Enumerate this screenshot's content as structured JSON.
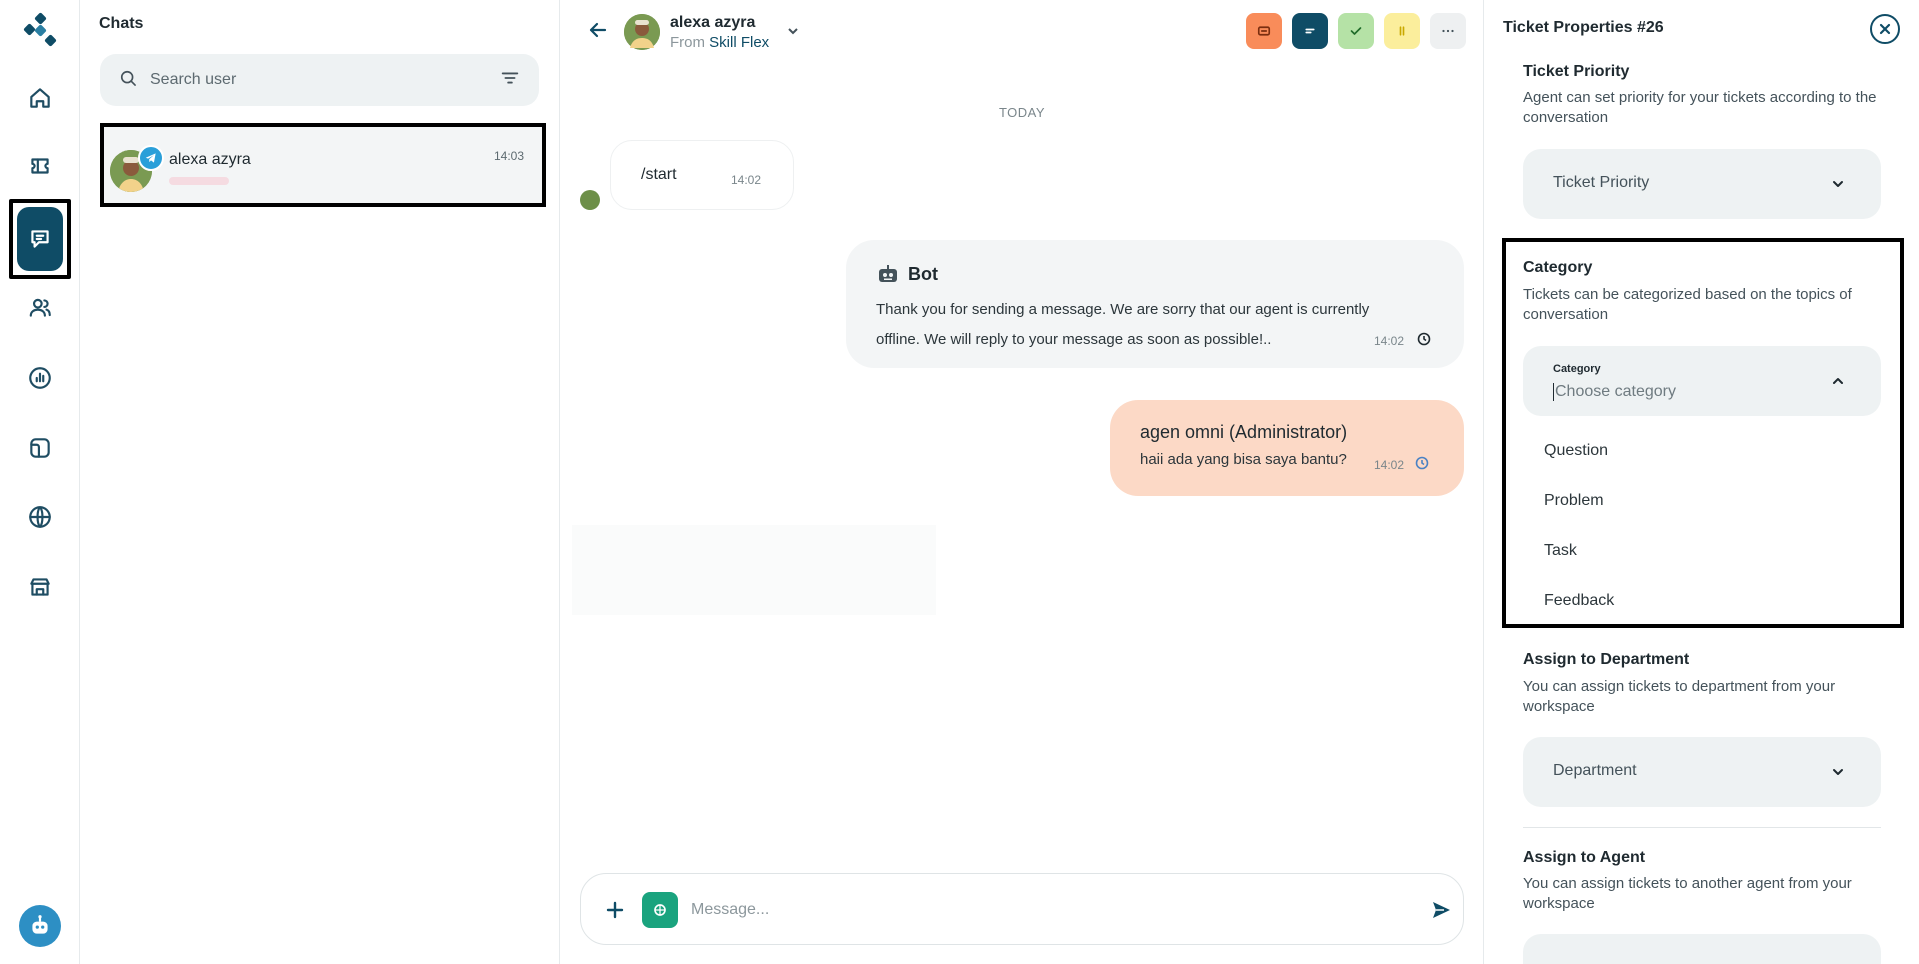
{
  "sidebar": {
    "items": [
      {
        "name": "home"
      },
      {
        "name": "tickets"
      },
      {
        "name": "chats"
      },
      {
        "name": "contacts"
      },
      {
        "name": "reports"
      },
      {
        "name": "channels"
      },
      {
        "name": "web"
      },
      {
        "name": "store"
      }
    ],
    "active": "chats"
  },
  "chat_list": {
    "title": "Chats",
    "search_placeholder": "Search user",
    "items": [
      {
        "name": "alexa azyra",
        "time": "14:03",
        "channel": "telegram"
      }
    ]
  },
  "conversation": {
    "contact_name": "alexa azyra",
    "from_label": "From",
    "from_source": "Skill Flex",
    "date_divider": "TODAY",
    "messages": [
      {
        "type": "incoming",
        "text": "/start",
        "time": "14:02"
      },
      {
        "type": "bot",
        "title": "Bot",
        "text": "Thank you for sending a message. We are sorry that our agent is currently offline. We will reply to your message as soon as possible!..",
        "time": "14:02"
      },
      {
        "type": "agent",
        "title": "agen omni (Administrator)",
        "text": "haii ada yang bisa saya bantu?",
        "time": "14:02"
      }
    ],
    "composer_placeholder": "Message...",
    "toolbar_colors": {
      "ticket": "#f98c5a",
      "notes": "#0f4c66",
      "resolve": "#b5e2a6",
      "pause": "#fbee9c",
      "more": "#eef0f1"
    }
  },
  "ticket_properties": {
    "title": "Ticket Properties #26",
    "priority": {
      "title": "Ticket Priority",
      "description": "Agent can set priority for your tickets according to the conversation",
      "select_label": "Ticket Priority"
    },
    "category": {
      "title": "Category",
      "description": "Tickets can be categorized based on the topics of conversation",
      "field_label": "Category",
      "placeholder": "Choose category",
      "options": [
        "Question",
        "Problem",
        "Task",
        "Feedback"
      ]
    },
    "department": {
      "title": "Assign to Department",
      "description": "You can assign tickets to department from your workspace",
      "select_label": "Department"
    },
    "agent": {
      "title": "Assign to Agent",
      "description": "You can assign tickets to another agent from your workspace"
    }
  }
}
